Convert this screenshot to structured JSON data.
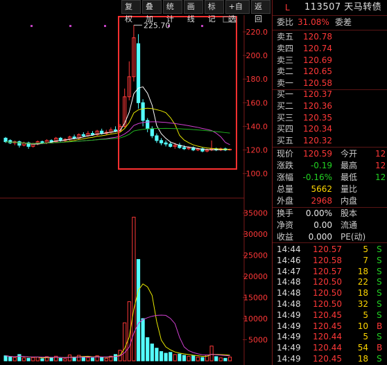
{
  "toolbar": {
    "buttons": [
      "复权",
      "叠加",
      "统计",
      "画线",
      "标记",
      "+自选",
      "返回"
    ]
  },
  "chart": {
    "max_price_label": "225.70",
    "price_axis_ticks": [
      "220.0",
      "200.0",
      "180.0",
      "160.0",
      "140.0",
      "120.0",
      "100.0"
    ],
    "volume_axis_ticks": [
      "35000",
      "30000",
      "25000",
      "20000",
      "15000",
      "10000",
      "5000"
    ],
    "colors": {
      "up": "#ff3838",
      "down": "#54ffff",
      "ma_white": "#ffffff",
      "ma_yellow": "#e6e600",
      "ma_magenta": "#d040d0",
      "ma_green": "#20b020",
      "highlight_box": "#ff3030"
    }
  },
  "quote": {
    "flag": "L",
    "code": "113507",
    "name": "天马转债",
    "weibi_label": "委比",
    "weibi_value": "31.08%",
    "weicha_label": "委差",
    "asks": [
      {
        "label": "卖五",
        "price": "120.78"
      },
      {
        "label": "卖四",
        "price": "120.74"
      },
      {
        "label": "卖三",
        "price": "120.69"
      },
      {
        "label": "卖二",
        "price": "120.65"
      },
      {
        "label": "卖一",
        "price": "120.58"
      }
    ],
    "bids": [
      {
        "label": "买一",
        "price": "120.37"
      },
      {
        "label": "买二",
        "price": "120.36"
      },
      {
        "label": "买三",
        "price": "120.35"
      },
      {
        "label": "买四",
        "price": "120.34"
      },
      {
        "label": "买五",
        "price": "120.32"
      }
    ],
    "stats": {
      "current_label": "现价",
      "current": "120.59",
      "open_label": "今开",
      "open": "12",
      "change_label": "涨跌",
      "change": "-0.19",
      "high_label": "最高",
      "high": "12",
      "pct_label": "涨幅",
      "pct": "-0.16%",
      "low_label": "最低",
      "low": "12",
      "volume_label": "总量",
      "volume": "5662",
      "vol_ratio_label": "量比",
      "outer_label": "外盘",
      "outer": "2968",
      "inner_label": "内盘"
    },
    "extra": {
      "turnover_label": "换手",
      "turnover": "0.00%",
      "capital_label": "股本",
      "netasset_label": "净资",
      "netasset": "0.00",
      "float_label": "流通",
      "earning_label": "收益",
      "earning": "0.000",
      "pe_label": "PE(动)"
    }
  },
  "ticks": [
    {
      "time": "14:44",
      "price": "120.57",
      "vol": "5",
      "side": "S",
      "dir": "up"
    },
    {
      "time": "14:46",
      "price": "120.58",
      "vol": "7",
      "side": "S",
      "dir": "up"
    },
    {
      "time": "14:47",
      "price": "120.57",
      "vol": "18",
      "side": "S",
      "dir": "up"
    },
    {
      "time": "14:48",
      "price": "120.50",
      "vol": "22",
      "side": "S",
      "dir": "up"
    },
    {
      "time": "14:48",
      "price": "120.50",
      "vol": "18",
      "side": "S",
      "dir": "up"
    },
    {
      "time": "14:48",
      "price": "120.50",
      "vol": "32",
      "side": "S",
      "dir": "up"
    },
    {
      "time": "14:49",
      "price": "120.45",
      "vol": "5",
      "side": "S",
      "dir": "up"
    },
    {
      "time": "14:49",
      "price": "120.45",
      "vol": "10",
      "side": "B",
      "dir": "up"
    },
    {
      "time": "14:49",
      "price": "120.44",
      "vol": "5",
      "side": "S",
      "dir": "up"
    },
    {
      "time": "14:49",
      "price": "120.44",
      "vol": "54",
      "side": "B",
      "dir": "up"
    },
    {
      "time": "14:49",
      "price": "120.45",
      "vol": "18",
      "side": "S",
      "dir": "up"
    }
  ]
}
